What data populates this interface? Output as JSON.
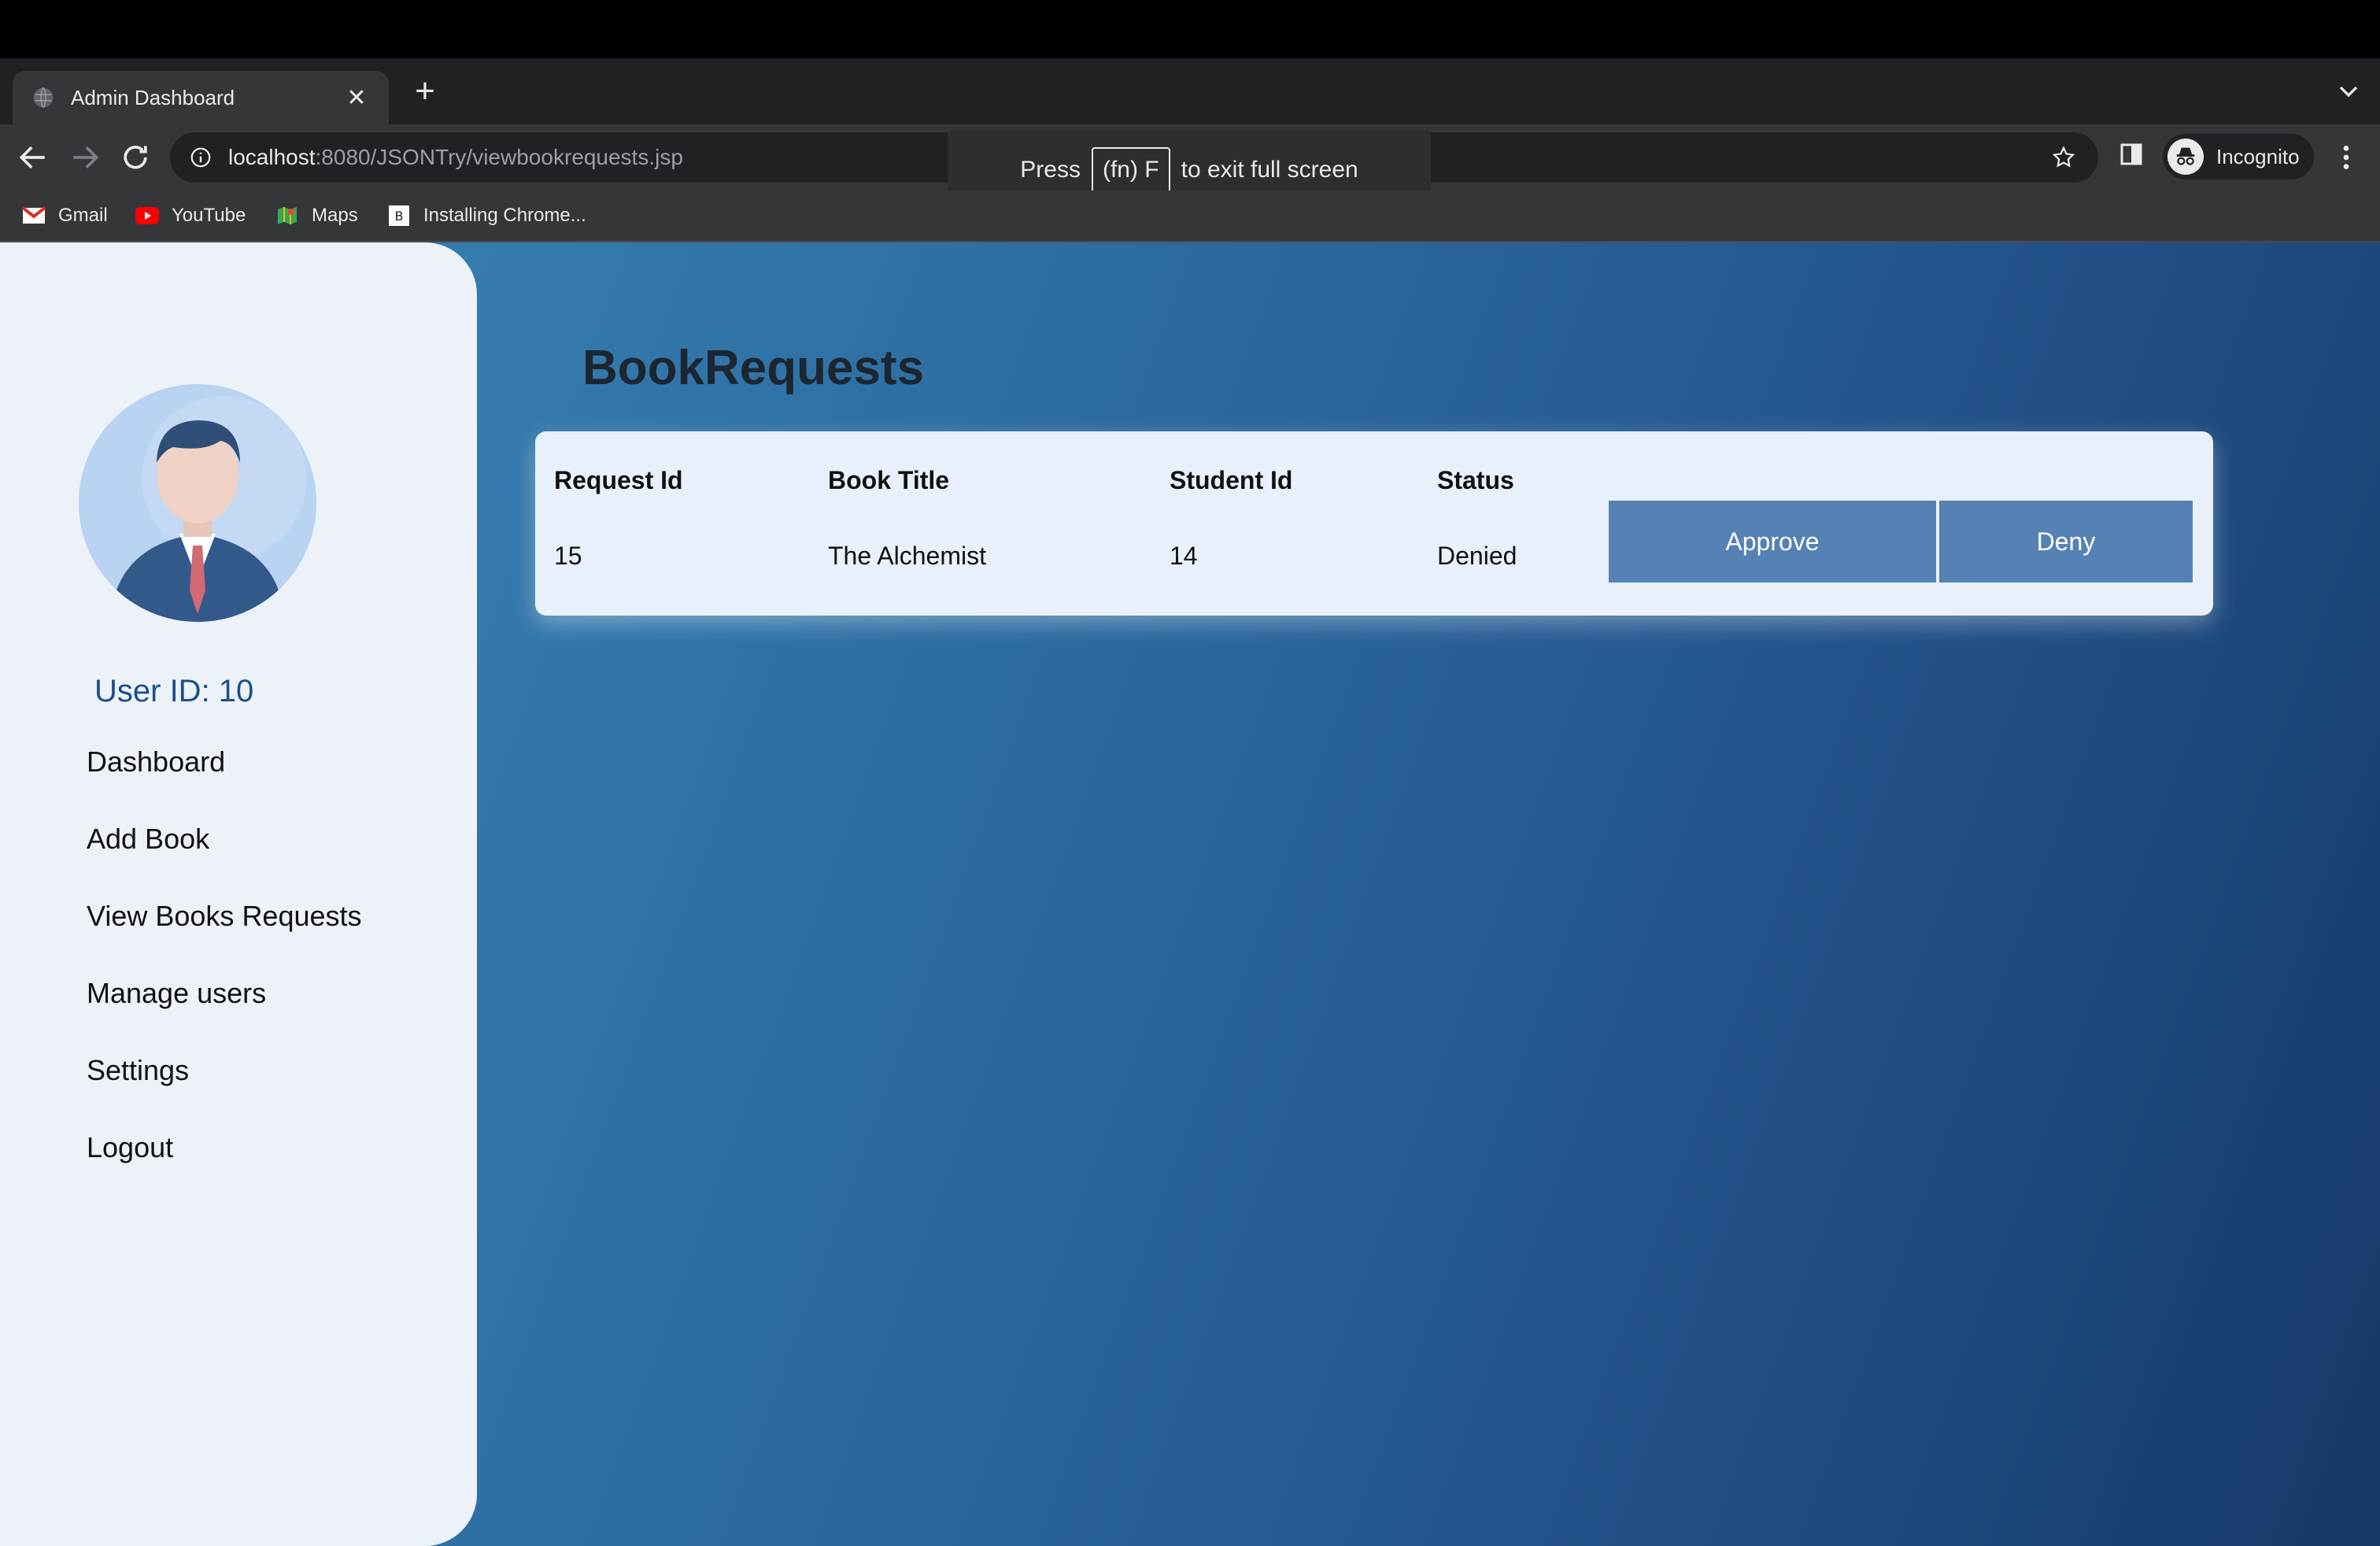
{
  "browser": {
    "tab_title": "Admin Dashboard",
    "url_host": "localhost",
    "url_path": ":8080/JSONTry/viewbookrequests.jsp",
    "profile_label": "Incognito",
    "bookmarks": [
      {
        "label": "Gmail",
        "icon": "gmail-icon"
      },
      {
        "label": "YouTube",
        "icon": "youtube-icon"
      },
      {
        "label": "Maps",
        "icon": "maps-icon"
      },
      {
        "label": "Installing Chrome...",
        "icon": "bookmark-b-icon"
      }
    ],
    "fullscreen_toast": {
      "prefix": "Press",
      "key": "(fn) F",
      "suffix": "to exit full screen"
    }
  },
  "sidebar": {
    "user_id": "User ID: 10",
    "menu": [
      {
        "label": "Dashboard"
      },
      {
        "label": "Add Book"
      },
      {
        "label": "View Books Requests"
      },
      {
        "label": "Manage users"
      },
      {
        "label": "Settings"
      },
      {
        "label": "Logout"
      }
    ]
  },
  "main": {
    "title": "BookRequests",
    "table": {
      "headers": [
        "Request Id",
        "Book Title",
        "Student Id",
        "Status"
      ],
      "rows": [
        {
          "request_id": "15",
          "book_title": "The Alchemist",
          "student_id": "14",
          "status": "Denied"
        }
      ]
    },
    "approve_label": "Approve",
    "deny_label": "Deny"
  },
  "colors": {
    "sidebar_bg": "#edf2f8",
    "button_bg": "#5581b4",
    "user_id_text": "#1c4f8c",
    "gradient_start": "#3b86b8",
    "gradient_end": "#163868"
  }
}
